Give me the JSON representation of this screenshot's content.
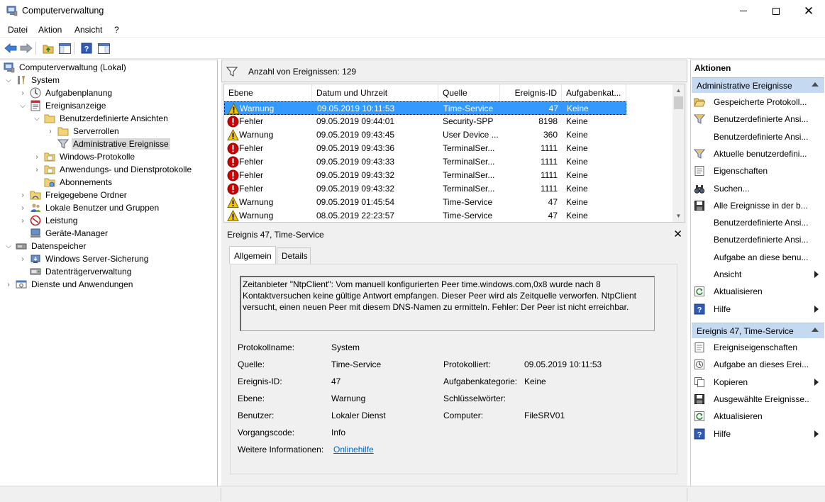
{
  "window": {
    "title": "Computerverwaltung"
  },
  "menu": [
    "Datei",
    "Aktion",
    "Ansicht",
    "?"
  ],
  "toolbar": {
    "icons": [
      "back-arrow-icon",
      "forward-arrow-icon",
      "up-folder-icon",
      "show-hide-tree-icon",
      "help-icon",
      "action-pane-icon"
    ]
  },
  "tree": {
    "root": "Computerverwaltung (Lokal)",
    "system": "System",
    "aufgabenplanung": "Aufgabenplanung",
    "ereignisanzeige": "Ereignisanzeige",
    "benutzerdefinierte": "Benutzerdefinierte Ansichten",
    "serverrollen": "Serverrollen",
    "administrative": "Administrative Ereignisse",
    "windowsprotokolle": "Windows-Protokolle",
    "anwendungsprotokolle": "Anwendungs- und Dienstprotokolle",
    "abonnements": "Abonnements",
    "freigegebene": "Freigegebene Ordner",
    "lokalebenutzer": "Lokale Benutzer und Gruppen",
    "leistung": "Leistung",
    "geraetemanager": "Geräte-Manager",
    "datenspeicher": "Datenspeicher",
    "serversicherung": "Windows Server-Sicherung",
    "datentraeger": "Datenträgerverwaltung",
    "dienste": "Dienste und Anwendungen"
  },
  "filterbar": {
    "label": "Anzahl von Ereignissen: 129"
  },
  "grid": {
    "columns": [
      "Ebene",
      "Datum und Uhrzeit",
      "Quelle",
      "Ereignis-ID",
      "Aufgabenkat..."
    ],
    "rows": [
      {
        "level": "Warnung",
        "type": "warning",
        "date": "09.05.2019 10:11:53",
        "source": "Time-Service",
        "id": "47",
        "task": "Keine",
        "selected": true
      },
      {
        "level": "Fehler",
        "type": "error",
        "date": "09.05.2019 09:44:01",
        "source": "Security-SPP",
        "id": "8198",
        "task": "Keine"
      },
      {
        "level": "Warnung",
        "type": "warning",
        "date": "09.05.2019 09:43:45",
        "source": "User Device ...",
        "id": "360",
        "task": "Keine"
      },
      {
        "level": "Fehler",
        "type": "error",
        "date": "09.05.2019 09:43:36",
        "source": "TerminalSer...",
        "id": "1111",
        "task": "Keine"
      },
      {
        "level": "Fehler",
        "type": "error",
        "date": "09.05.2019 09:43:33",
        "source": "TerminalSer...",
        "id": "1111",
        "task": "Keine"
      },
      {
        "level": "Fehler",
        "type": "error",
        "date": "09.05.2019 09:43:32",
        "source": "TerminalSer...",
        "id": "1111",
        "task": "Keine"
      },
      {
        "level": "Fehler",
        "type": "error",
        "date": "09.05.2019 09:43:32",
        "source": "TerminalSer...",
        "id": "1111",
        "task": "Keine"
      },
      {
        "level": "Warnung",
        "type": "warning",
        "date": "09.05.2019 01:45:54",
        "source": "Time-Service",
        "id": "47",
        "task": "Keine"
      },
      {
        "level": "Warnung",
        "type": "warning",
        "date": "08.05.2019 22:23:57",
        "source": "Time-Service",
        "id": "47",
        "task": "Keine"
      }
    ]
  },
  "detail": {
    "title": "Ereignis 47, Time-Service",
    "tabs": [
      "Allgemein",
      "Details"
    ],
    "message": "Zeitanbieter \"NtpClient\": Vom manuell konfigurierten Peer time.windows.com,0x8 wurde nach 8 Kontaktversuchen keine gültige Antwort empfangen. Dieser Peer wird als Zeitquelle verworfen. NtpClient versucht, einen neuen Peer mit diesem DNS-Namen zu ermitteln. Fehler: Der Peer ist nicht erreichbar.",
    "labels": {
      "protokollname": "Protokollname:",
      "quelle": "Quelle:",
      "ereignisid": "Ereignis-ID:",
      "ebene": "Ebene:",
      "benutzer": "Benutzer:",
      "vorgangscode": "Vorgangscode:",
      "weitere": "Weitere Informationen:",
      "protokolliert": "Protokolliert:",
      "aufgabenkategorie": "Aufgabenkategorie:",
      "schluesselwoerter": "Schlüsselwörter:",
      "computer": "Computer:"
    },
    "values": {
      "protokollname": "System",
      "quelle": "Time-Service",
      "ereignisid": "47",
      "ebene": "Warnung",
      "benutzer": "Lokaler Dienst",
      "vorgangscode": "Info",
      "weitere": "Onlinehilfe",
      "protokolliert": "09.05.2019 10:11:53",
      "aufgabenkategorie": "Keine",
      "schluesselwoerter": "",
      "computer": "FileSRV01"
    }
  },
  "actions": {
    "title": "Aktionen",
    "section1": "Administrative Ereignisse",
    "items1": [
      {
        "label": "Gespeicherte Protokoll...",
        "icon": "open-folder-icon"
      },
      {
        "label": "Benutzerdefinierte Ansi...",
        "icon": "filter-icon"
      },
      {
        "label": "Benutzerdefinierte Ansi...",
        "icon": "none"
      },
      {
        "label": "Aktuelle benutzerdefini...",
        "icon": "filter-icon"
      },
      {
        "label": "Eigenschaften",
        "icon": "properties-icon"
      },
      {
        "label": "Suchen...",
        "icon": "binoculars-icon"
      },
      {
        "label": "Alle Ereignisse in der b...",
        "icon": "save-icon"
      },
      {
        "label": "Benutzerdefinierte Ansi...",
        "icon": "none"
      },
      {
        "label": "Benutzerdefinierte Ansi...",
        "icon": "none"
      },
      {
        "label": "Aufgabe an diese benu...",
        "icon": "none"
      },
      {
        "label": "Ansicht",
        "icon": "none",
        "submenu": true
      },
      {
        "label": "Aktualisieren",
        "icon": "refresh-icon"
      },
      {
        "label": "Hilfe",
        "icon": "help-icon",
        "submenu": true
      }
    ],
    "section2": "Ereignis 47, Time-Service",
    "items2": [
      {
        "label": "Ereigniseigenschaften",
        "icon": "properties-icon"
      },
      {
        "label": "Aufgabe an dieses Erei...",
        "icon": "task-clock-icon"
      },
      {
        "label": "Kopieren",
        "icon": "copy-icon",
        "submenu": true
      },
      {
        "label": "Ausgewählte Ereignisse...",
        "icon": "save-icon"
      },
      {
        "label": "Aktualisieren",
        "icon": "refresh-icon"
      },
      {
        "label": "Hilfe",
        "icon": "help-icon",
        "submenu": true
      }
    ]
  },
  "colors": {
    "selection": "#3399ff",
    "section_header": "#c5d9f1",
    "link": "#0066cc",
    "error": "#cc0000",
    "warning": "#f5c400"
  }
}
